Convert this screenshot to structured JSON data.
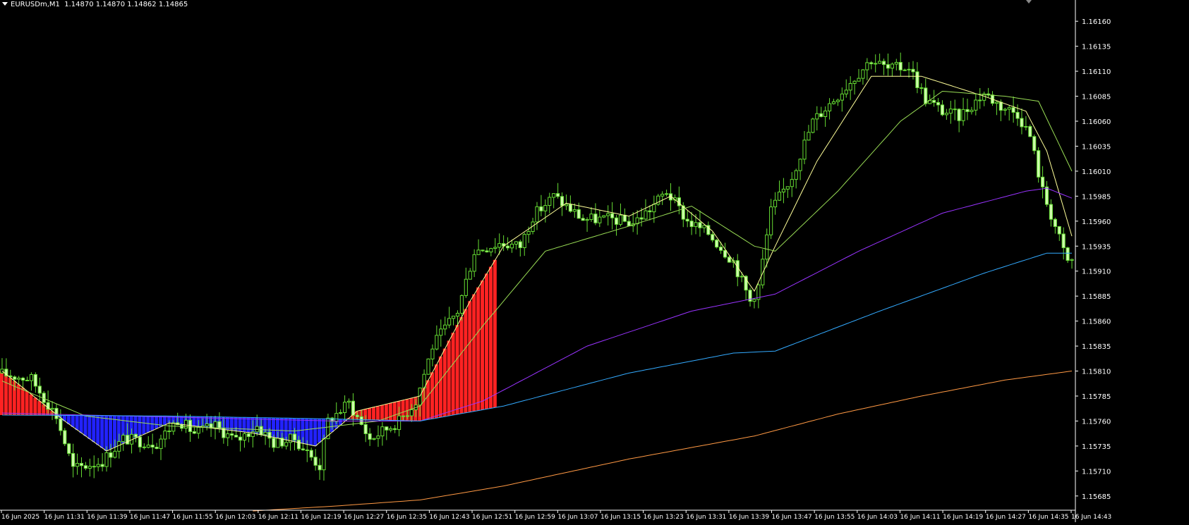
{
  "header": {
    "symbol": "EURUSDm,M1",
    "ohlc": "1.14870 1.14870 1.14862 1.14865"
  },
  "colors": {
    "background": "#000000",
    "axis": "#ffffff",
    "candle_up_fill": "#000000",
    "candle_down_fill": "#ccffaa",
    "candle_wick": "#66dd33",
    "ma_fast": "#ffff99",
    "ma_medium": "#99dd55",
    "ma_purple": "#9933ff",
    "ma_blue": "#33aaff",
    "ma_orange": "#ff9944",
    "hist_positive": "#ff2222",
    "hist_negative": "#2222ff"
  },
  "chart_data": {
    "type": "candlestick",
    "title": "EURUSDm,M1",
    "timeframe": "M1",
    "grid": false,
    "y_ticks": [
      "1.16160",
      "1.16135",
      "1.16110",
      "1.16085",
      "1.16060",
      "1.16035",
      "1.16010",
      "1.15985",
      "1.15960",
      "1.15935",
      "1.15910",
      "1.15885",
      "1.15860",
      "1.15835",
      "1.15810",
      "1.15785",
      "1.15760",
      "1.15735",
      "1.15710",
      "1.15685"
    ],
    "ylim": [
      1.15675,
      1.1617
    ],
    "x_ticks": [
      "16 Jun 2025",
      "16 Jun 11:31",
      "16 Jun 11:39",
      "16 Jun 11:47",
      "16 Jun 11:55",
      "16 Jun 12:03",
      "16 Jun 12:11",
      "16 Jun 12:19",
      "16 Jun 12:27",
      "16 Jun 12:35",
      "16 Jun 12:43",
      "16 Jun 12:51",
      "16 Jun 12:59",
      "16 Jun 13:07",
      "16 Jun 13:15",
      "16 Jun 13:23",
      "16 Jun 13:31",
      "16 Jun 13:39",
      "16 Jun 13:47",
      "16 Jun 13:55",
      "16 Jun 14:03",
      "16 Jun 14:11",
      "16 Jun 14:19",
      "16 Jun 14:27",
      "16 Jun 14:35",
      "16 Jun 14:43"
    ],
    "price_path": [
      [
        0,
        1.15808
      ],
      [
        8,
        1.15802
      ],
      [
        14,
        1.15765
      ],
      [
        18,
        1.15712
      ],
      [
        25,
        1.1572
      ],
      [
        30,
        1.15742
      ],
      [
        38,
        1.15738
      ],
      [
        43,
        1.15762
      ],
      [
        47,
        1.15748
      ],
      [
        52,
        1.15755
      ],
      [
        57,
        1.1574
      ],
      [
        62,
        1.15755
      ],
      [
        66,
        1.15738
      ],
      [
        71,
        1.15742
      ],
      [
        77,
        1.15715
      ],
      [
        79,
        1.1576
      ],
      [
        84,
        1.15778
      ],
      [
        89,
        1.15742
      ],
      [
        96,
        1.1576
      ],
      [
        100,
        1.1578
      ],
      [
        104,
        1.15835
      ],
      [
        110,
        1.1587
      ],
      [
        114,
        1.1593
      ],
      [
        120,
        1.15938
      ],
      [
        125,
        1.15935
      ],
      [
        128,
        1.15965
      ],
      [
        133,
        1.15985
      ],
      [
        140,
        1.15962
      ],
      [
        147,
        1.15962
      ],
      [
        152,
        1.15958
      ],
      [
        156,
        1.15972
      ],
      [
        160,
        1.1599
      ],
      [
        165,
        1.1596
      ],
      [
        170,
        1.15948
      ],
      [
        176,
        1.1592
      ],
      [
        180,
        1.1588
      ],
      [
        182,
        1.15895
      ],
      [
        185,
        1.1597
      ],
      [
        190,
        1.16005
      ],
      [
        195,
        1.1606
      ],
      [
        203,
        1.16095
      ],
      [
        209,
        1.16122
      ],
      [
        213,
        1.16112
      ],
      [
        218,
        1.16115
      ],
      [
        222,
        1.16082
      ],
      [
        226,
        1.1607
      ],
      [
        230,
        1.16065
      ],
      [
        236,
        1.16088
      ],
      [
        240,
        1.16075
      ],
      [
        244,
        1.16068
      ],
      [
        247,
        1.16045
      ],
      [
        250,
        1.1599
      ],
      [
        253,
        1.15955
      ],
      [
        255,
        1.1593
      ],
      [
        256,
        1.1592
      ]
    ],
    "series": [
      {
        "name": "",
        "anchors": [
          [
            0,
            1.1581
          ],
          [
            15,
            1.1576
          ],
          [
            25,
            1.1573
          ],
          [
            40,
            1.15758
          ],
          [
            60,
            1.15748
          ],
          [
            75,
            1.15735
          ],
          [
            85,
            1.1577
          ],
          [
            100,
            1.15785
          ],
          [
            112,
            1.1588
          ],
          [
            120,
            1.15935
          ],
          [
            135,
            1.15978
          ],
          [
            150,
            1.15965
          ],
          [
            160,
            1.15985
          ],
          [
            170,
            1.1595
          ],
          [
            180,
            1.1589
          ],
          [
            185,
            1.15935
          ],
          [
            195,
            1.1602
          ],
          [
            208,
            1.16105
          ],
          [
            220,
            1.16105
          ],
          [
            235,
            1.16085
          ],
          [
            245,
            1.1607
          ],
          [
            250,
            1.1603
          ],
          [
            256,
            1.15945
          ]
        ]
      },
      {
        "name": "",
        "anchors": [
          [
            0,
            1.158
          ],
          [
            20,
            1.15765
          ],
          [
            40,
            1.15755
          ],
          [
            70,
            1.1575
          ],
          [
            90,
            1.1576
          ],
          [
            100,
            1.15775
          ],
          [
            115,
            1.15855
          ],
          [
            130,
            1.1593
          ],
          [
            150,
            1.15955
          ],
          [
            165,
            1.15975
          ],
          [
            180,
            1.15935
          ],
          [
            185,
            1.1593
          ],
          [
            200,
            1.1599
          ],
          [
            215,
            1.1606
          ],
          [
            225,
            1.1609
          ],
          [
            240,
            1.16085
          ],
          [
            248,
            1.1608
          ],
          [
            256,
            1.1601
          ]
        ]
      },
      {
        "name": "",
        "anchors": [
          [
            0,
            1.15768
          ],
          [
            40,
            1.15764
          ],
          [
            80,
            1.1576
          ],
          [
            100,
            1.1576
          ],
          [
            115,
            1.1578
          ],
          [
            140,
            1.15835
          ],
          [
            165,
            1.1587
          ],
          [
            185,
            1.15887
          ],
          [
            205,
            1.1593
          ],
          [
            225,
            1.15968
          ],
          [
            245,
            1.1599
          ],
          [
            250,
            1.15993
          ],
          [
            256,
            1.15983
          ]
        ]
      },
      {
        "name": "",
        "anchors": [
          [
            0,
            1.15766
          ],
          [
            40,
            1.15765
          ],
          [
            80,
            1.15762
          ],
          [
            100,
            1.1576
          ],
          [
            120,
            1.15775
          ],
          [
            150,
            1.15808
          ],
          [
            175,
            1.15828
          ],
          [
            185,
            1.1583
          ],
          [
            210,
            1.1587
          ],
          [
            235,
            1.15908
          ],
          [
            250,
            1.15928
          ],
          [
            256,
            1.15928
          ]
        ]
      },
      {
        "name": "",
        "anchors": [
          [
            60,
            1.1567
          ],
          [
            80,
            1.15675
          ],
          [
            100,
            1.15681
          ],
          [
            120,
            1.15695
          ],
          [
            150,
            1.15722
          ],
          [
            180,
            1.15745
          ],
          [
            200,
            1.15767
          ],
          [
            220,
            1.15785
          ],
          [
            240,
            1.15801
          ],
          [
            256,
            1.1581
          ]
        ]
      }
    ],
    "histogram_baseline_series": 3,
    "histogram_range": [
      0,
      118
    ],
    "last_bar": {
      "open": 1.1487,
      "high": 1.1487,
      "low": 1.14862,
      "close": 1.14865
    }
  }
}
